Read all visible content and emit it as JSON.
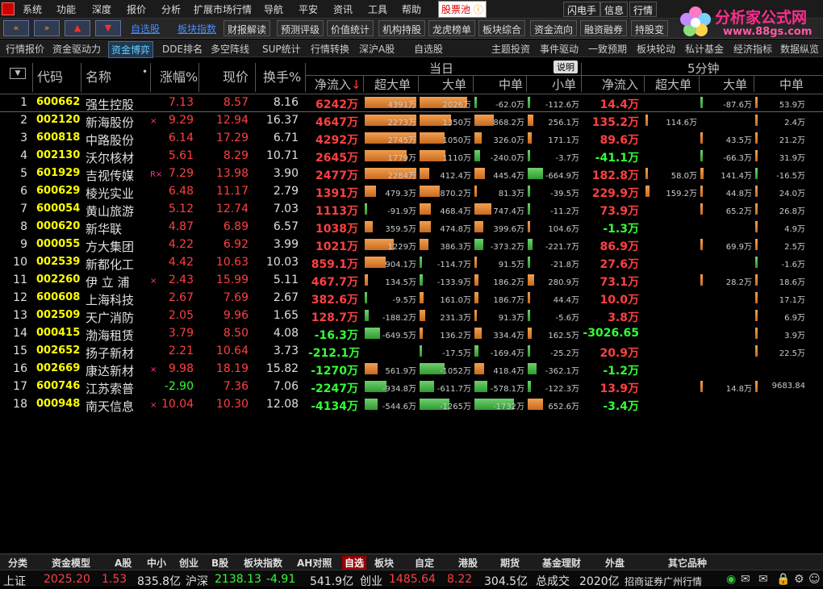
{
  "menubar": {
    "items": [
      "系统",
      "功能",
      "深度",
      "报价",
      "分析",
      "扩展市场行情",
      "导航",
      "平安",
      "资讯",
      "工具",
      "帮助"
    ],
    "highlight": "股票池",
    "right_buttons": [
      "闪电手",
      "信息",
      "行情"
    ]
  },
  "toolbar": {
    "nav_buttons": [
      "«",
      "»",
      "▲",
      "▼"
    ],
    "links": [
      "自选股",
      "板块指数"
    ],
    "buttons": [
      "财报解读",
      "预测评级",
      "价值统计",
      "机构持股",
      "龙虎榜单",
      "板块综合",
      "资金流向",
      "融资融券",
      "持股变"
    ]
  },
  "brand": {
    "title": "分析家公式网",
    "url": "www.88gs.com"
  },
  "tabs2": {
    "items": [
      "行情报价",
      "资金驱动力",
      "资金博弈",
      "DDE排名",
      "多空阵线",
      "SUP统计",
      "行情转换",
      "深沪A股",
      "自选股",
      "主题投资",
      "事件驱动",
      "一致预期",
      "板块轮动",
      "私计基金",
      "经济指标",
      "数据纵览"
    ],
    "selected": "资金博弈"
  },
  "table": {
    "headers": {
      "code": "代码",
      "name": "名称",
      "change": "涨幅%",
      "price": "现价",
      "turnover": "换手%"
    },
    "group_today": "当日",
    "group_5min": "5分钟",
    "explain_button": "说明",
    "sub_headers": [
      "净流入",
      "超大单",
      "大单",
      "中单",
      "小单",
      "净流入",
      "超大单",
      "大单",
      "中单"
    ],
    "rows": [
      {
        "idx": "1",
        "code": "600662",
        "name": "强生控股",
        "flag": "",
        "chg": "7.13",
        "price": "8.57",
        "turn": "8.16",
        "net": "6242万",
        "netc": "r",
        "b1": "4391万",
        "b2": "2026万",
        "b3": "-62.0万",
        "b4": "-112.6万",
        "n5": "14.4万",
        "n5c": "r",
        "c1": "",
        "c2": "-87.6万",
        "c3": "53.9万"
      },
      {
        "idx": "2",
        "code": "002120",
        "name": "新海股份",
        "flag": "×",
        "chg": "9.29",
        "price": "12.94",
        "turn": "16.37",
        "net": "4647万",
        "netc": "r",
        "b1": "2273万",
        "b2": "1350万",
        "b3": "868.2万",
        "b4": "256.1万",
        "n5": "135.2万",
        "n5c": "r",
        "c1": "114.6万",
        "c2": "",
        "c3": "2.4万"
      },
      {
        "idx": "3",
        "code": "600818",
        "name": "中路股份",
        "flag": "",
        "chg": "6.14",
        "price": "17.29",
        "turn": "6.71",
        "net": "4292万",
        "netc": "r",
        "b1": "2745万",
        "b2": "1050万",
        "b3": "326.0万",
        "b4": "171.1万",
        "n5": "89.6万",
        "n5c": "r",
        "c1": "",
        "c2": "43.5万",
        "c3": "21.2万"
      },
      {
        "idx": "4",
        "code": "002130",
        "name": "沃尔核材",
        "flag": "",
        "chg": "5.61",
        "price": "8.29",
        "turn": "10.71",
        "net": "2645万",
        "netc": "r",
        "b1": "1779万",
        "b2": "1110万",
        "b3": "-240.0万",
        "b4": "-3.7万",
        "n5": "-41.1万",
        "n5c": "g",
        "c1": "",
        "c2": "-66.3万",
        "c3": "31.9万"
      },
      {
        "idx": "5",
        "code": "601929",
        "name": "吉视传媒",
        "flag": "R×",
        "chg": "7.29",
        "price": "13.98",
        "turn": "3.90",
        "net": "2477万",
        "netc": "r",
        "b1": "2284万",
        "b2": "412.4万",
        "b3": "445.4万",
        "b4": "-664.9万",
        "n5": "182.8万",
        "n5c": "r",
        "c1": "58.0万",
        "c2": "141.4万",
        "c3": "-16.5万"
      },
      {
        "idx": "6",
        "code": "600629",
        "name": "棱光实业",
        "flag": "",
        "chg": "6.48",
        "price": "11.17",
        "turn": "2.79",
        "net": "1391万",
        "netc": "r",
        "b1": "479.3万",
        "b2": "870.2万",
        "b3": "81.3万",
        "b4": "-39.5万",
        "n5": "229.9万",
        "n5c": "r",
        "c1": "159.2万",
        "c2": "44.8万",
        "c3": "24.0万"
      },
      {
        "idx": "7",
        "code": "600054",
        "name": "黄山旅游",
        "flag": "",
        "chg": "5.12",
        "price": "12.74",
        "turn": "7.03",
        "net": "1113万",
        "netc": "r",
        "b1": "-91.9万",
        "b2": "468.4万",
        "b3": "747.4万",
        "b4": "-11.2万",
        "n5": "73.9万",
        "n5c": "r",
        "c1": "",
        "c2": "65.2万",
        "c3": "26.8万"
      },
      {
        "idx": "8",
        "code": "000620",
        "name": "新华联",
        "flag": "",
        "chg": "4.87",
        "price": "6.89",
        "turn": "6.57",
        "net": "1038万",
        "netc": "r",
        "b1": "359.5万",
        "b2": "474.8万",
        "b3": "399.6万",
        "b4": "104.6万",
        "n5": "-1.3万",
        "n5c": "g",
        "c1": "",
        "c2": "",
        "c3": "4.9万"
      },
      {
        "idx": "9",
        "code": "000055",
        "name": "方大集团",
        "flag": "",
        "chg": "4.22",
        "price": "6.92",
        "turn": "3.99",
        "net": "1021万",
        "netc": "r",
        "b1": "1229万",
        "b2": "386.3万",
        "b3": "-373.2万",
        "b4": "-221.7万",
        "n5": "86.9万",
        "n5c": "r",
        "c1": "",
        "c2": "69.9万",
        "c3": "2.5万"
      },
      {
        "idx": "10",
        "code": "002539",
        "name": "新都化工",
        "flag": "",
        "chg": "4.42",
        "price": "10.63",
        "turn": "10.03",
        "net": "859.1万",
        "netc": "r",
        "b1": "904.1万",
        "b2": "-114.7万",
        "b3": "91.5万",
        "b4": "-21.8万",
        "n5": "27.6万",
        "n5c": "r",
        "c1": "",
        "c2": "",
        "c3": "-1.6万"
      },
      {
        "idx": "11",
        "code": "002260",
        "name": "伊 立 浦",
        "flag": "×",
        "chg": "2.43",
        "price": "15.99",
        "turn": "5.11",
        "net": "467.7万",
        "netc": "r",
        "b1": "134.5万",
        "b2": "-133.9万",
        "b3": "186.2万",
        "b4": "280.9万",
        "n5": "73.1万",
        "n5c": "r",
        "c1": "",
        "c2": "28.2万",
        "c3": "18.6万"
      },
      {
        "idx": "12",
        "code": "600608",
        "name": "上海科技",
        "flag": "",
        "chg": "2.67",
        "price": "7.69",
        "turn": "2.67",
        "net": "382.6万",
        "netc": "r",
        "b1": "-9.5万",
        "b2": "161.0万",
        "b3": "186.7万",
        "b4": "44.4万",
        "n5": "10.0万",
        "n5c": "r",
        "c1": "",
        "c2": "",
        "c3": "17.1万"
      },
      {
        "idx": "13",
        "code": "002509",
        "name": "天广消防",
        "flag": "",
        "chg": "2.05",
        "price": "9.96",
        "turn": "1.65",
        "net": "128.7万",
        "netc": "r",
        "b1": "-188.2万",
        "b2": "231.3万",
        "b3": "91.3万",
        "b4": "-5.6万",
        "n5": "3.8万",
        "n5c": "r",
        "c1": "",
        "c2": "",
        "c3": "6.9万"
      },
      {
        "idx": "14",
        "code": "000415",
        "name": "渤海租赁",
        "flag": "",
        "chg": "3.79",
        "price": "8.50",
        "turn": "4.08",
        "net": "-16.3万",
        "netc": "g",
        "b1": "-649.5万",
        "b2": "136.2万",
        "b3": "334.4万",
        "b4": "162.5万",
        "n5": "-3026.65",
        "n5c": "g",
        "c1": "",
        "c2": "",
        "c3": "3.9万"
      },
      {
        "idx": "15",
        "code": "002652",
        "name": "扬子新材",
        "flag": "",
        "chg": "2.21",
        "price": "10.64",
        "turn": "3.73",
        "net": "-212.1万",
        "netc": "g",
        "b1": "",
        "b2": "-17.5万",
        "b3": "-169.4万",
        "b4": "-25.2万",
        "n5": "20.9万",
        "n5c": "r",
        "c1": "",
        "c2": "",
        "c3": "22.5万"
      },
      {
        "idx": "16",
        "code": "002669",
        "name": "康达新材",
        "flag": "×",
        "chg": "9.98",
        "price": "18.19",
        "turn": "15.82",
        "net": "-1270万",
        "netc": "g",
        "b1": "561.9万",
        "b2": "-1052万",
        "b3": "418.4万",
        "b4": "-362.1万",
        "n5": "-1.2万",
        "n5c": "g",
        "c1": "",
        "c2": "",
        "c3": ""
      },
      {
        "idx": "17",
        "code": "600746",
        "name": "江苏索普",
        "flag": "",
        "chg": "-2.90",
        "price": "7.36",
        "turn": "7.06",
        "net": "-2247万",
        "netc": "g",
        "b1": "-934.8万",
        "b2": "-611.7万",
        "b3": "-578.1万",
        "b4": "-122.3万",
        "n5": "13.9万",
        "n5c": "r",
        "c1": "",
        "c2": "14.8万",
        "c3": "9683.84"
      },
      {
        "idx": "18",
        "code": "000948",
        "name": "南天信息",
        "flag": "×",
        "chg": "10.04",
        "price": "10.30",
        "turn": "12.08",
        "net": "-4134万",
        "netc": "g",
        "b1": "-544.6万",
        "b2": "-1265万",
        "b3": "-1732万",
        "b4": "652.6万",
        "n5": "-3.4万",
        "n5c": "g",
        "c1": "",
        "c2": "",
        "c3": ""
      }
    ]
  },
  "bottomtabs": {
    "items": [
      "分类",
      "资金模型",
      "A股",
      "中小",
      "创业",
      "B股",
      "板块指数",
      "AH对照",
      "自选",
      "板块",
      "自定",
      "港股",
      "期货",
      "基金理财",
      "外盘",
      "其它品种"
    ],
    "selected": "自选"
  },
  "statusbar": {
    "sh_label": "上证",
    "sh_val": "2025.20",
    "sh_chg": "1.53",
    "sh_amt": "835.8亿",
    "hs_label": "沪深",
    "hs_val": "2138.13",
    "hs_chg": "-4.91",
    "hs_amt": "541.9亿",
    "cy_label": "创业",
    "cy_val": "1485.64",
    "cy_chg": "8.22",
    "cy_amt": "304.5亿",
    "total_label": "总成交",
    "total_amt": "2020亿",
    "broker": "招商证券广州行情"
  }
}
